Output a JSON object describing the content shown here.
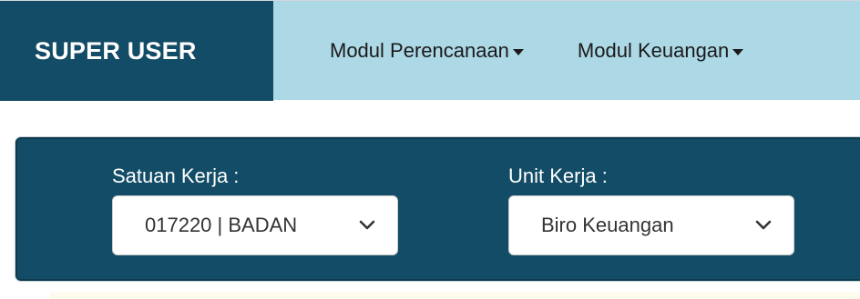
{
  "navbar": {
    "brand": "SUPER USER",
    "menu": [
      {
        "label": "Modul Perencanaan"
      },
      {
        "label": "Modul Keuangan"
      }
    ]
  },
  "filters": {
    "satker": {
      "label": "Satuan Kerja :",
      "selected": "017220 | BADAN"
    },
    "unit": {
      "label": "Unit Kerja :",
      "selected": "Biro Keuangan"
    }
  },
  "icons": {
    "dropdown_caret": "caret-down-icon",
    "select_chevron": "chevron-down-icon"
  },
  "colors": {
    "brand_bg": "#134c66",
    "navbar_bg": "#add8e6",
    "panel_bg": "#134c66"
  }
}
